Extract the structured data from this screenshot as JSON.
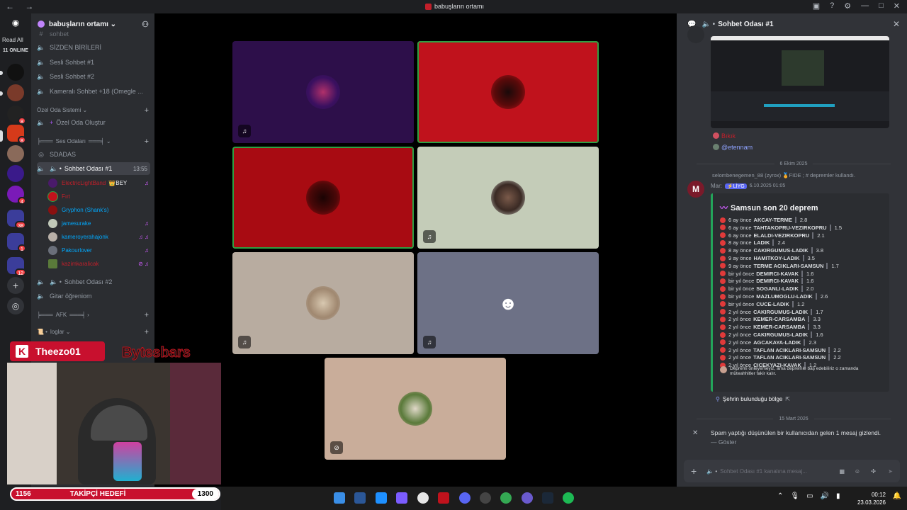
{
  "window": {
    "title": "babuşların ortamı",
    "nav": "← →"
  },
  "rail": {
    "read_all": "Read All",
    "online": "11 ONLINE",
    "badges": [
      "8",
      "8",
      "4",
      "38",
      "1",
      "12"
    ]
  },
  "sidebar": {
    "guild_name": "babuşların ortamı ⌄",
    "channels_top": [
      "sohbet",
      "SİZDEN BİRİLERİ",
      "Sesli Sohbet #1",
      "Sesli Sohbet #2",
      "Kameralı Sohbet +18 (Omegle ..."
    ],
    "category_ozel": "Özel Oda Sistemi ⌄",
    "ozel_create": "Özel Oda Oluştur",
    "category_ses": "Ses Odaları",
    "sdadas": "SDADAS",
    "active_channel": "Sohbet Odası #1",
    "active_time": "13:55",
    "voice_users": [
      {
        "name": "ElectricLightBand",
        "tag": "👑BEY",
        "color": "#c21f2a"
      },
      {
        "name": "Fırt",
        "tag": "",
        "color": "#c21f2a"
      },
      {
        "name": "Gryphon (Shank's)",
        "tag": "",
        "color": "#00a8fc"
      },
      {
        "name": "jamesurake",
        "tag": "",
        "color": "#00a8fc"
      },
      {
        "name": "kameroyerahajonk",
        "tag": "",
        "color": "#00a8fc"
      },
      {
        "name": "Pakourlover",
        "tag": "",
        "color": "#00a8fc"
      },
      {
        "name": "kazimkaralicak",
        "tag": "",
        "color": "#c21f2a"
      }
    ],
    "room2": "Sohbet Odası #2",
    "gitar": "Gitar öğreniom",
    "category_afk": "AFK",
    "category_loglar": "loglar ⌄",
    "log_item": "log"
  },
  "chat": {
    "header": "Sohbet Odası #1",
    "user1": "Bıkık",
    "user2": "@etennam",
    "date1": "6 Ekim 2025",
    "reply_line": "selombenegemen_88 (zyrox) 🏅FIDE ; # depremler kullandı.",
    "author": "Mar:",
    "app_tag": "⚡LİYG",
    "timestamp": "6.10.2025 01:05",
    "embed_title": "Samsun son 20 deprem",
    "quakes": [
      {
        "when": "6 ay önce",
        "loc": "AKCAY-TERME",
        "mag": "2.8"
      },
      {
        "when": "6 ay önce",
        "loc": "TAHTAKOPRU-VEZIRKOPRU",
        "mag": "1.5"
      },
      {
        "when": "6 ay önce",
        "loc": "ELALDI-VEZIRKOPRU",
        "mag": "2.1"
      },
      {
        "when": "8 ay önce",
        "loc": "LADIK",
        "mag": "2.4"
      },
      {
        "when": "8 ay önce",
        "loc": "CAKIRGUMUS-LADIK",
        "mag": "3.8"
      },
      {
        "when": "9 ay önce",
        "loc": "HAMITKOY-LADIK",
        "mag": "3.5"
      },
      {
        "when": "9 ay önce",
        "loc": "TERME ACIKLARI-SAMSUN",
        "mag": "1.7"
      },
      {
        "when": "bir yıl önce",
        "loc": "DEMIRCI-KAVAK",
        "mag": "1.6"
      },
      {
        "when": "bir yıl önce",
        "loc": "DEMIRCI-KAVAK",
        "mag": "1.6"
      },
      {
        "when": "bir yıl önce",
        "loc": "SOGANLI-LADIK",
        "mag": "2.0"
      },
      {
        "when": "bir yıl önce",
        "loc": "MAZLUMOGLU-LADIK",
        "mag": "2.6"
      },
      {
        "when": "bir yıl önce",
        "loc": "CUCE-LADIK",
        "mag": "1.2"
      },
      {
        "when": "2 yıl önce",
        "loc": "CAKIRGUMUS-LADIK",
        "mag": "1.7"
      },
      {
        "when": "2 yıl önce",
        "loc": "KEMER-CARSAMBA",
        "mag": "3.3"
      },
      {
        "when": "2 yıl önce",
        "loc": "KEMER-CARSAMBA",
        "mag": "3.3"
      },
      {
        "when": "2 yıl önce",
        "loc": "CAKIRGUMUS-LADIK",
        "mag": "1.6"
      },
      {
        "when": "2 yıl önce",
        "loc": "AGCAKAYA-LADIK",
        "mag": "2.3"
      },
      {
        "when": "2 yıl önce",
        "loc": "TAFLAN ACIKLARI-SAMSUN",
        "mag": "2.2"
      },
      {
        "when": "2 yıl önce",
        "loc": "TAFLAN ACIKLARI-SAMSUN",
        "mag": "2.2"
      },
      {
        "when": "2 yıl önce",
        "loc": "CICEKYAZI-KAVAK",
        "mag": "1.2"
      }
    ],
    "footer_text": "Depremi önleyemeyiz, ama depremle baş edebiliriz o zamanda müteahhitler fakir kalır.",
    "location_button": "Şehrin bulunduğu bölge",
    "date2": "15 Mart 2026",
    "spam_notice": "Spam yaptığı düşünülen bir kullanıcıdan gelen 1 mesaj gizlendi.",
    "show_link": "— Göster",
    "input_placeholder": "Sohbet Odası #1 kanalına mesaj..."
  },
  "overlay": {
    "streamer": "Theezo01",
    "brand": "Bytesbars",
    "goal_current": "1156",
    "goal_label": "TAKİPÇİ HEDEFİ",
    "goal_target": "1300"
  },
  "taskbar": {
    "time": "00:12",
    "date": "23.03.2026"
  },
  "colors": {
    "accent": "#5865f2",
    "red_tile": "#c0121c",
    "green_speaking": "#2ea043"
  }
}
